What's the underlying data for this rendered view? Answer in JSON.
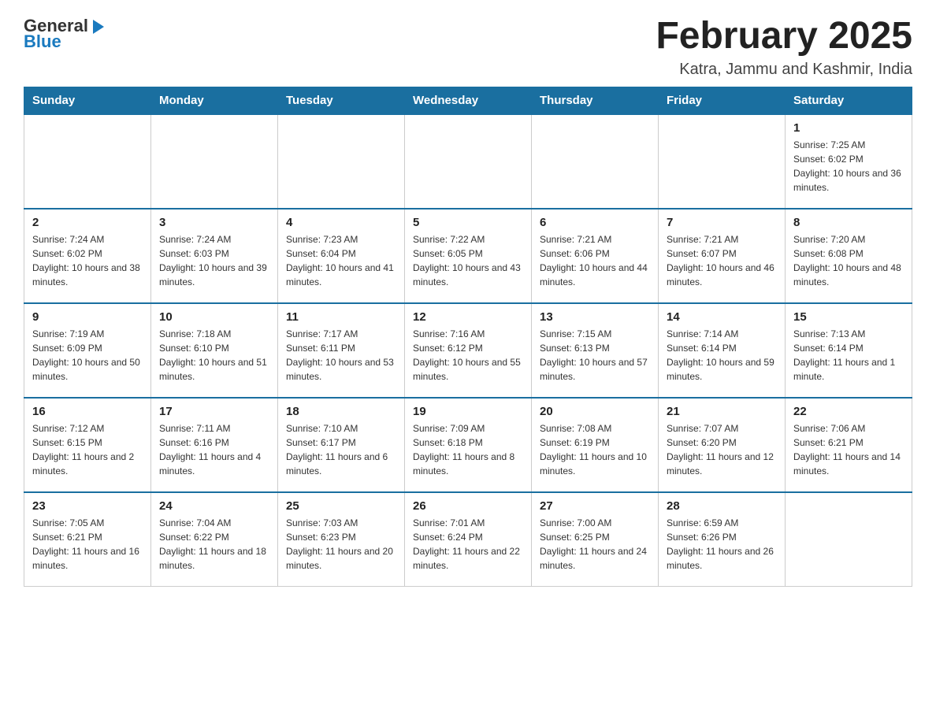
{
  "header": {
    "logo_general": "General",
    "logo_blue": "Blue",
    "month_title": "February 2025",
    "location": "Katra, Jammu and Kashmir, India"
  },
  "days_of_week": [
    "Sunday",
    "Monday",
    "Tuesday",
    "Wednesday",
    "Thursday",
    "Friday",
    "Saturday"
  ],
  "weeks": [
    [
      {
        "day": "",
        "info": ""
      },
      {
        "day": "",
        "info": ""
      },
      {
        "day": "",
        "info": ""
      },
      {
        "day": "",
        "info": ""
      },
      {
        "day": "",
        "info": ""
      },
      {
        "day": "",
        "info": ""
      },
      {
        "day": "1",
        "info": "Sunrise: 7:25 AM\nSunset: 6:02 PM\nDaylight: 10 hours and 36 minutes."
      }
    ],
    [
      {
        "day": "2",
        "info": "Sunrise: 7:24 AM\nSunset: 6:02 PM\nDaylight: 10 hours and 38 minutes."
      },
      {
        "day": "3",
        "info": "Sunrise: 7:24 AM\nSunset: 6:03 PM\nDaylight: 10 hours and 39 minutes."
      },
      {
        "day": "4",
        "info": "Sunrise: 7:23 AM\nSunset: 6:04 PM\nDaylight: 10 hours and 41 minutes."
      },
      {
        "day": "5",
        "info": "Sunrise: 7:22 AM\nSunset: 6:05 PM\nDaylight: 10 hours and 43 minutes."
      },
      {
        "day": "6",
        "info": "Sunrise: 7:21 AM\nSunset: 6:06 PM\nDaylight: 10 hours and 44 minutes."
      },
      {
        "day": "7",
        "info": "Sunrise: 7:21 AM\nSunset: 6:07 PM\nDaylight: 10 hours and 46 minutes."
      },
      {
        "day": "8",
        "info": "Sunrise: 7:20 AM\nSunset: 6:08 PM\nDaylight: 10 hours and 48 minutes."
      }
    ],
    [
      {
        "day": "9",
        "info": "Sunrise: 7:19 AM\nSunset: 6:09 PM\nDaylight: 10 hours and 50 minutes."
      },
      {
        "day": "10",
        "info": "Sunrise: 7:18 AM\nSunset: 6:10 PM\nDaylight: 10 hours and 51 minutes."
      },
      {
        "day": "11",
        "info": "Sunrise: 7:17 AM\nSunset: 6:11 PM\nDaylight: 10 hours and 53 minutes."
      },
      {
        "day": "12",
        "info": "Sunrise: 7:16 AM\nSunset: 6:12 PM\nDaylight: 10 hours and 55 minutes."
      },
      {
        "day": "13",
        "info": "Sunrise: 7:15 AM\nSunset: 6:13 PM\nDaylight: 10 hours and 57 minutes."
      },
      {
        "day": "14",
        "info": "Sunrise: 7:14 AM\nSunset: 6:14 PM\nDaylight: 10 hours and 59 minutes."
      },
      {
        "day": "15",
        "info": "Sunrise: 7:13 AM\nSunset: 6:14 PM\nDaylight: 11 hours and 1 minute."
      }
    ],
    [
      {
        "day": "16",
        "info": "Sunrise: 7:12 AM\nSunset: 6:15 PM\nDaylight: 11 hours and 2 minutes."
      },
      {
        "day": "17",
        "info": "Sunrise: 7:11 AM\nSunset: 6:16 PM\nDaylight: 11 hours and 4 minutes."
      },
      {
        "day": "18",
        "info": "Sunrise: 7:10 AM\nSunset: 6:17 PM\nDaylight: 11 hours and 6 minutes."
      },
      {
        "day": "19",
        "info": "Sunrise: 7:09 AM\nSunset: 6:18 PM\nDaylight: 11 hours and 8 minutes."
      },
      {
        "day": "20",
        "info": "Sunrise: 7:08 AM\nSunset: 6:19 PM\nDaylight: 11 hours and 10 minutes."
      },
      {
        "day": "21",
        "info": "Sunrise: 7:07 AM\nSunset: 6:20 PM\nDaylight: 11 hours and 12 minutes."
      },
      {
        "day": "22",
        "info": "Sunrise: 7:06 AM\nSunset: 6:21 PM\nDaylight: 11 hours and 14 minutes."
      }
    ],
    [
      {
        "day": "23",
        "info": "Sunrise: 7:05 AM\nSunset: 6:21 PM\nDaylight: 11 hours and 16 minutes."
      },
      {
        "day": "24",
        "info": "Sunrise: 7:04 AM\nSunset: 6:22 PM\nDaylight: 11 hours and 18 minutes."
      },
      {
        "day": "25",
        "info": "Sunrise: 7:03 AM\nSunset: 6:23 PM\nDaylight: 11 hours and 20 minutes."
      },
      {
        "day": "26",
        "info": "Sunrise: 7:01 AM\nSunset: 6:24 PM\nDaylight: 11 hours and 22 minutes."
      },
      {
        "day": "27",
        "info": "Sunrise: 7:00 AM\nSunset: 6:25 PM\nDaylight: 11 hours and 24 minutes."
      },
      {
        "day": "28",
        "info": "Sunrise: 6:59 AM\nSunset: 6:26 PM\nDaylight: 11 hours and 26 minutes."
      },
      {
        "day": "",
        "info": ""
      }
    ]
  ]
}
